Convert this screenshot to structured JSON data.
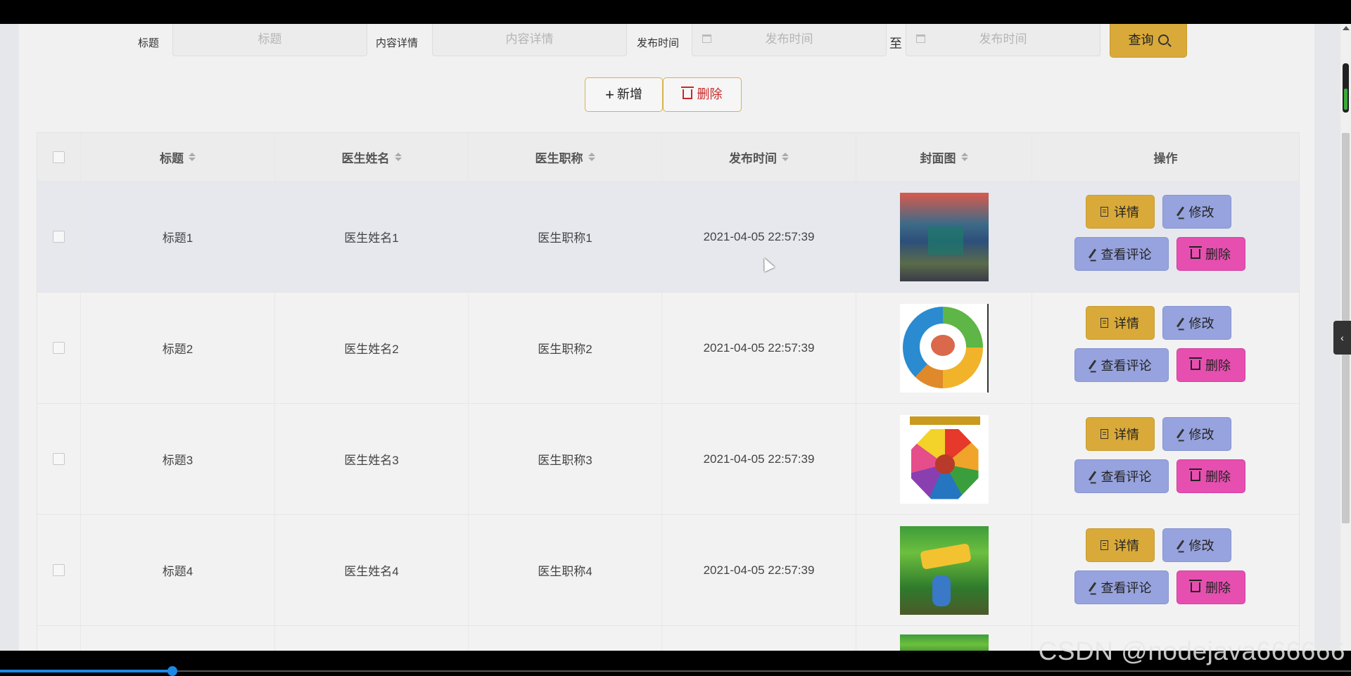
{
  "search": {
    "title_label": "标题",
    "title_placeholder": "标题",
    "content_label": "内容详情",
    "content_placeholder": "内容详情",
    "time_label": "发布时间",
    "time_start_placeholder": "发布时间",
    "range_separator": "至",
    "time_end_placeholder": "发布时间",
    "query_label": "查询"
  },
  "actions": {
    "add_label": "新增",
    "delete_label": "删除"
  },
  "table": {
    "columns": [
      "标题",
      "医生姓名",
      "医生职称",
      "发布时间",
      "封面图",
      "操作"
    ],
    "rows": [
      {
        "title": "标题1",
        "doctor_name": "医生姓名1",
        "doctor_title": "医生职称1",
        "publish_time": "2021-04-05 22:57:39",
        "cover": "classroom-photo"
      },
      {
        "title": "标题2",
        "doctor_name": "医生姓名2",
        "doctor_title": "医生职称2",
        "publish_time": "2021-04-05 22:57:39",
        "cover": "brain-wheel-chart"
      },
      {
        "title": "标题3",
        "doctor_name": "医生姓名3",
        "doctor_title": "医生职称3",
        "publish_time": "2021-04-05 22:57:39",
        "cover": "octagon-chart"
      },
      {
        "title": "标题4",
        "doctor_name": "医生姓名4",
        "doctor_title": "医生职称4",
        "publish_time": "2021-04-05 22:57:39",
        "cover": "cartoon-poster"
      }
    ],
    "row_actions": {
      "detail": "详情",
      "edit": "修改",
      "comments": "查看评论",
      "remove": "删除"
    }
  },
  "colors": {
    "primary_gold": "#d9aa3a",
    "edit_blue": "#97a3de",
    "delete_pink": "#e64fb0",
    "danger_red": "#c92828"
  },
  "watermark": "CSDN @nodejava666666"
}
